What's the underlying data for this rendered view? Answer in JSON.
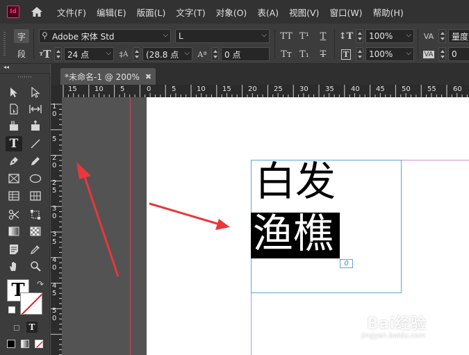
{
  "app": {
    "logo_text": "Id"
  },
  "menu": [
    "文件(F)",
    "编辑(E)",
    "版面(L)",
    "文字(T)",
    "对象(O)",
    "表(A)",
    "视图(V)",
    "窗口(W)",
    "帮助(H)"
  ],
  "control_panel": {
    "char_mode_label": "字",
    "para_mode_label": "段",
    "font_family": "Adobe 宋体 Std",
    "font_style": "L",
    "font_size": "24 点",
    "leading": "(28.8 点",
    "baseline_shift": "0 点",
    "vertical_scale": "100%",
    "horizontal_scale": "100%",
    "kerning_label": "量度",
    "tracking": "0",
    "icon_labels": {
      "caps": "TT",
      "superscript": "T¹",
      "underline": "T",
      "small_caps": "Tт",
      "subscript": "T₁",
      "strikethrough": "T",
      "kerning": "VA",
      "tracking": "VA",
      "size": "T",
      "leading": "A",
      "baseline": "Aª"
    }
  },
  "document": {
    "tab_title": "*未命名-1 @ 200%",
    "tab_close": "✖",
    "h_ruler_labels": [
      "15",
      "10",
      "5",
      "0",
      "5",
      "10",
      "15",
      "20",
      "25",
      "30",
      "35",
      "40",
      "45",
      "50",
      "55",
      "60"
    ],
    "v_ruler_labels": [
      "1|0",
      "5",
      "2|0",
      "2|5",
      "3|0",
      "3|5",
      "4|0",
      "4|5",
      "5|0"
    ],
    "text_line1": "白发",
    "text_line2_selected": "渔樵",
    "overset_marker": "0"
  },
  "toolbox": {
    "collapse_label": "◂◂",
    "type_tool_label": "T",
    "fill_swatch_label": "T",
    "mode_type_label": "T"
  },
  "watermark": {
    "word": "Bai经验",
    "url": "jingyan.baidu.com"
  },
  "colors": {
    "annotation_arrow": "#e8383d",
    "bleed_guide": "#c8435f",
    "margin_guide": "#d98cd4",
    "frame_edge": "#5aa7d6",
    "indesign_brand": "#ff3366"
  }
}
